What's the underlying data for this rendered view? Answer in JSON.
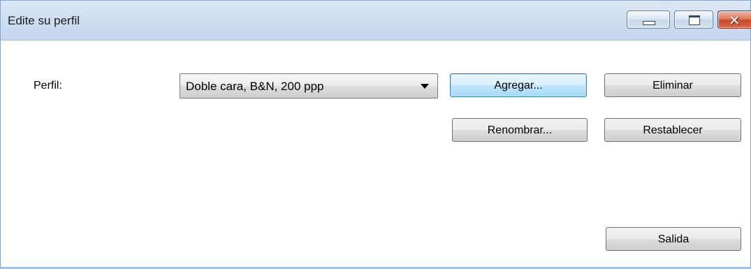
{
  "window": {
    "title": "Edite su perfil",
    "controls": {
      "minimize": "minimize-icon",
      "maximize": "maximize-icon",
      "close": "close-icon"
    }
  },
  "form": {
    "profile_label": "Perfil:",
    "profile_selected": "Doble cara, B&N, 200 ppp"
  },
  "buttons": {
    "add": "Agregar...",
    "delete": "Eliminar",
    "rename": "Renombrar...",
    "reset": "Restablecer",
    "exit": "Salida"
  },
  "colors": {
    "titlebar": "#cfdff1",
    "default_button_border": "#3c7fb1",
    "close_button": "#c84a2a"
  }
}
